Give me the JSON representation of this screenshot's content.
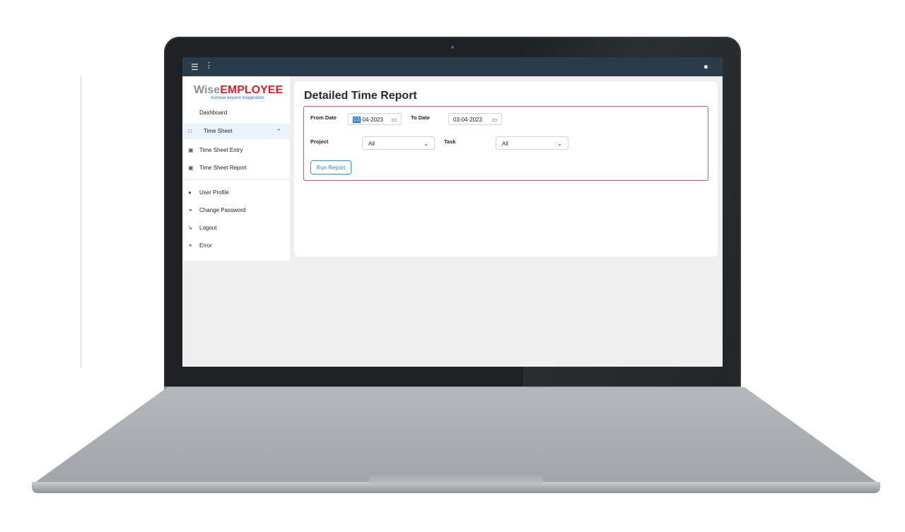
{
  "app": {
    "logo_wise": "Wise",
    "logo_employee": "EMPLOYEE",
    "tagline": "Achieve beyond Imagination"
  },
  "topbar": {
    "menu_icon": "hamburger-icon",
    "user_icon": "user-icon"
  },
  "sidebar": {
    "items": [
      {
        "label": "Dashboard",
        "icon": ""
      },
      {
        "label": "Time Sheet",
        "icon": "calendar-icon",
        "active": true,
        "expanded": true
      },
      {
        "label": "Time Sheet Entry",
        "icon": "calendar-icon"
      },
      {
        "label": "Time Sheet Report",
        "icon": "calendar-check-icon"
      },
      {
        "label": "User Profile",
        "icon": "user-icon"
      },
      {
        "label": "Change Password",
        "icon": "key-icon"
      },
      {
        "label": "Logout",
        "icon": "logout-icon"
      },
      {
        "label": "Error",
        "icon": "key-icon"
      }
    ]
  },
  "report": {
    "title": "Detailed Time Report",
    "from_date_label": "From Date",
    "from_date_highlight": "03",
    "from_date_rest": "-04-2023",
    "to_date_label": "To Date",
    "to_date_value": "03-04-2023",
    "project_label": "Project",
    "project_value": "All",
    "task_label": "Task",
    "task_value": "All",
    "run_button": "Run Report"
  },
  "colors": {
    "topbar": "#2a3b4a",
    "brand_red": "#e01e27",
    "accent_blue": "#2f8fdd",
    "filter_border": "#e8495f"
  }
}
